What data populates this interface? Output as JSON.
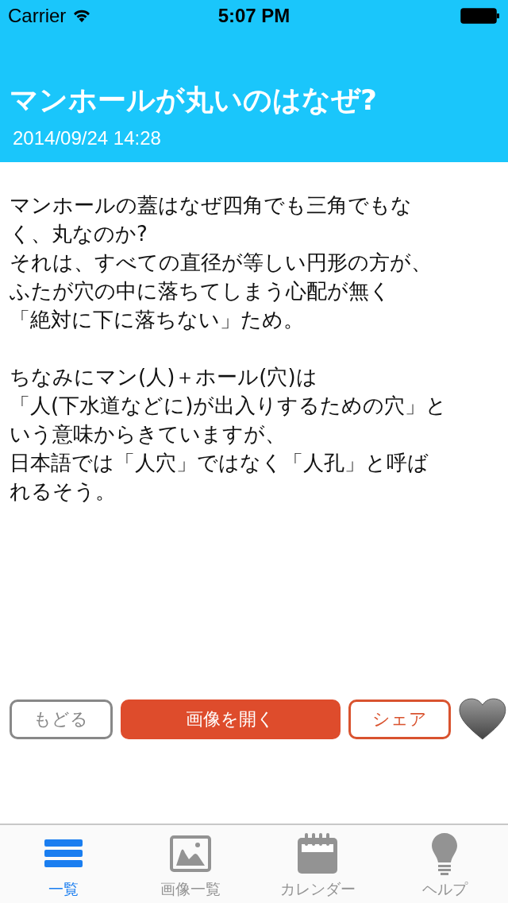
{
  "status_bar": {
    "carrier": "Carrier",
    "time": "5:07 PM"
  },
  "header": {
    "title": "マンホールが丸いのはなぜ?",
    "date": "2014/09/24 14:28"
  },
  "article": {
    "paragraphs": [
      [
        "マンホールの蓋はなぜ四角でも三角でもな",
        "く、丸なのか?",
        "それは、すべての直径が等しい円形の方が、",
        "ふたが穴の中に落ちてしまう心配が無く",
        "「絶対に下に落ちない」ため。"
      ],
      [
        "ちなみにマン(人)＋ホール(穴)は",
        "「人(下水道などに)が出入りするための穴」と",
        "いう意味からきていますが、",
        "日本語では「人穴」ではなく「人孔」と呼ば",
        "れるそう。"
      ]
    ]
  },
  "actions": [
    {
      "kind": "back",
      "label": "もどる"
    },
    {
      "kind": "primary",
      "label": "画像を開く"
    },
    {
      "kind": "share",
      "label": "シェア"
    }
  ],
  "favorite": false,
  "tab_bar": [
    {
      "kind": "list",
      "label": "一覧",
      "selected": true
    },
    {
      "kind": "images",
      "label": "画像一覧",
      "selected": false
    },
    {
      "kind": "calendar",
      "label": "カレンダー",
      "selected": false
    },
    {
      "kind": "help",
      "label": "ヘルプ",
      "selected": false
    }
  ]
}
